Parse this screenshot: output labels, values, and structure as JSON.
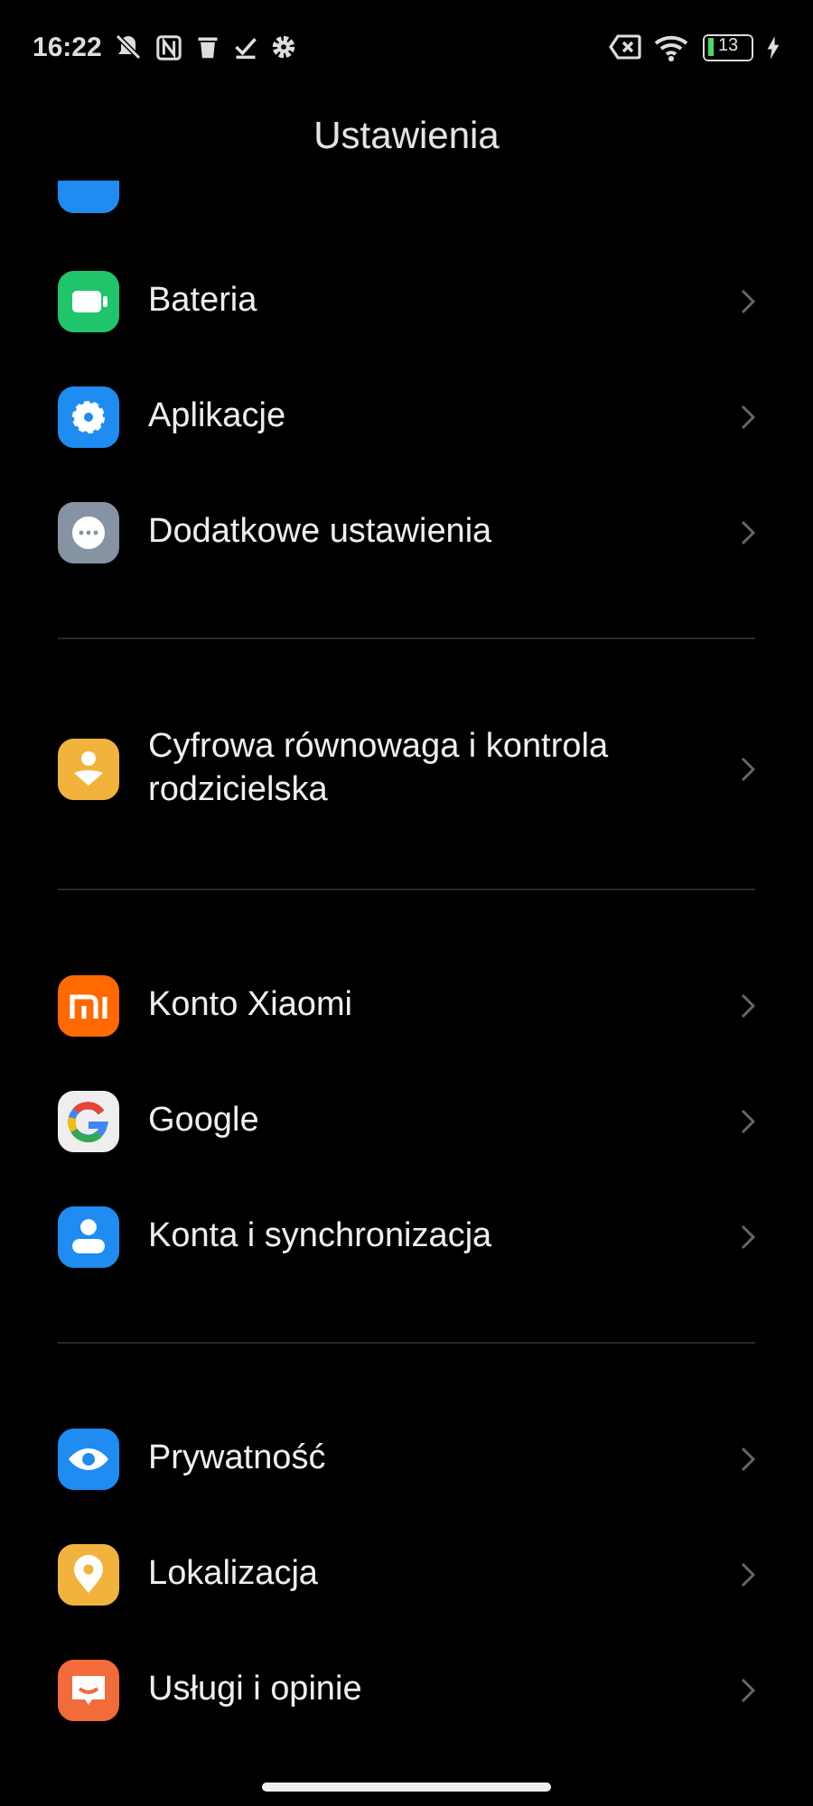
{
  "status_bar": {
    "time": "16:22",
    "battery": "13"
  },
  "title": "Ustawienia",
  "groups": [
    {
      "items": [
        {
          "label": "Bateria",
          "color": "#1fc46b"
        },
        {
          "label": "Aplikacje",
          "color": "#1e8cf0"
        },
        {
          "label": "Dodatkowe ustawienia",
          "color": "#8593a2"
        }
      ]
    },
    {
      "items": [
        {
          "label": "Cyfrowa równowaga i kontrola rodzicielska",
          "color": "#f2b33d"
        }
      ]
    },
    {
      "items": [
        {
          "label": "Konto Xiaomi",
          "color": "#ff6900"
        },
        {
          "label": "Google",
          "color": "#eeeeee"
        },
        {
          "label": "Konta i synchronizacja",
          "color": "#1e8cf0"
        }
      ]
    },
    {
      "items": [
        {
          "label": "Prywatność",
          "color": "#1e8cf0"
        },
        {
          "label": "Lokalizacja",
          "color": "#f2b33d"
        },
        {
          "label": "Usługi i opinie",
          "color": "#f26b3a"
        }
      ]
    }
  ]
}
